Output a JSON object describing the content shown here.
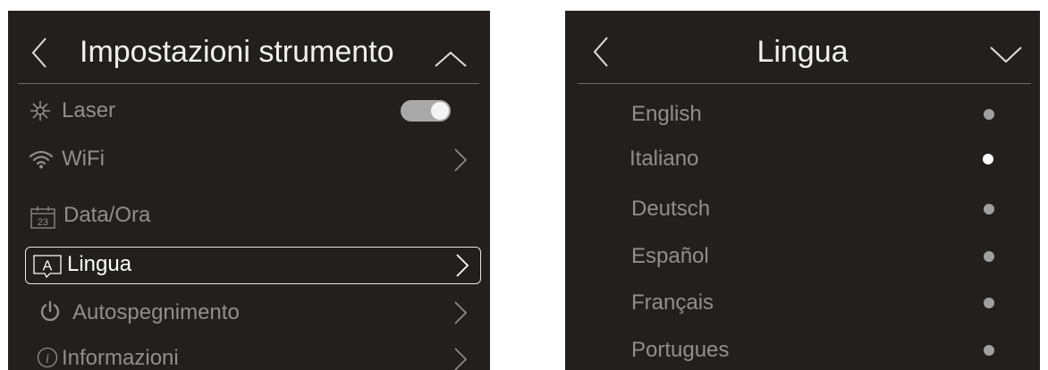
{
  "left_panel": {
    "title": "Impostazioni strumento",
    "back_icon": "chevron-left-icon",
    "collapse_icon": "chevron-up-icon",
    "items": [
      {
        "label": "Laser",
        "icon": "laser-icon",
        "control": "toggle",
        "toggle_on": true
      },
      {
        "label": "WiFi",
        "icon": "wifi-icon",
        "control": "chevron-right-icon"
      },
      {
        "label": "Data/Ora",
        "icon": "calendar-icon",
        "icon_text": "23"
      },
      {
        "label": "Lingua",
        "icon": "language-icon",
        "icon_text": "A",
        "control": "chevron-right-icon",
        "selected": true
      },
      {
        "label": "Autospegnimento",
        "icon": "power-icon",
        "control": "chevron-right-icon"
      },
      {
        "label": "Informazioni",
        "icon": "info-icon",
        "icon_text": "i",
        "control": "chevron-right-icon"
      }
    ]
  },
  "right_panel": {
    "title": "Lingua",
    "back_icon": "chevron-left-icon",
    "expand_icon": "chevron-down-icon",
    "languages": [
      {
        "label": "English",
        "selected": false
      },
      {
        "label": "Italiano",
        "selected": true
      },
      {
        "label": "Deutsch",
        "selected": false
      },
      {
        "label": "Español",
        "selected": false
      },
      {
        "label": "Français",
        "selected": false
      },
      {
        "label": "Portugues",
        "selected": false
      }
    ]
  },
  "colors": {
    "panel_background": "#231f1c",
    "text_active": "#ffffff",
    "text_inactive": "#8f8f8f",
    "toggle_track": "#a9a9a9",
    "toggle_knob": "#f4f4f4"
  }
}
